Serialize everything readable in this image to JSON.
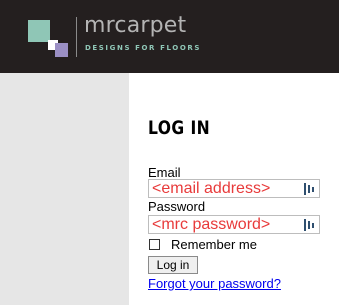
{
  "header": {
    "brand_name": "mrcarpet",
    "tagline": "DESIGNS FOR FLOORS",
    "logo_colors": {
      "teal": "#8fc6b6",
      "lilac": "#9b8fc4",
      "background": "#241f1f"
    }
  },
  "login": {
    "title": "LOG IN",
    "email_label": "Email",
    "email_value": "<email address>",
    "password_label": "Password",
    "password_value": "<mrc password>",
    "remember_label": "Remember me",
    "remember_checked": false,
    "submit_label": "Log in",
    "forgot_link": "Forgot your password?",
    "field_icon": "password-manager-key-icon",
    "field_value_color": "#e83a3a"
  }
}
